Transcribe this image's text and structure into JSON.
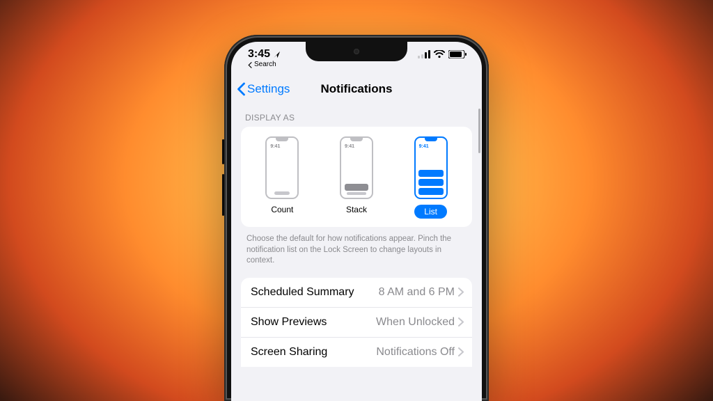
{
  "status": {
    "time": "3:45",
    "breadcrumb": "Search"
  },
  "nav": {
    "back": "Settings",
    "title": "Notifications"
  },
  "display_as": {
    "header": "DISPLAY AS",
    "options": [
      {
        "label": "Count",
        "preview_time": "9:41",
        "selected": false
      },
      {
        "label": "Stack",
        "preview_time": "9:41",
        "selected": false
      },
      {
        "label": "List",
        "preview_time": "9:41",
        "selected": true
      }
    ],
    "footnote": "Choose the default for how notifications appear. Pinch the notification list on the Lock Screen to change layouts in context."
  },
  "rows": [
    {
      "label": "Scheduled Summary",
      "value": "8 AM and 6 PM"
    },
    {
      "label": "Show Previews",
      "value": "When Unlocked"
    },
    {
      "label": "Screen Sharing",
      "value": "Notifications Off"
    }
  ]
}
